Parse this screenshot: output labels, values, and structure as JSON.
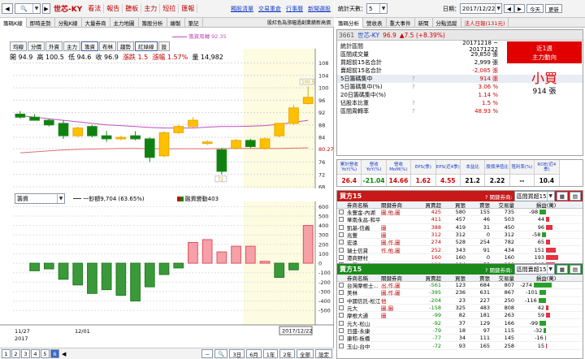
{
  "left": {
    "nav": {
      "back": "◀",
      "forward": "▶",
      "search_icon": "magnifier",
      "stock": "世芯-KY",
      "buttons": [
        "看法",
        "報告",
        "聽板",
        "主力",
        "短拉",
        "匯報"
      ],
      "links": [
        "獨股清單",
        "交易重倉",
        "行事曆",
        "新聞選股"
      ]
    },
    "tabs": [
      "籌碼K線",
      "即時走勢",
      "分點K線",
      "大量券商",
      "主力地圖",
      "籌股分析",
      "繪製",
      "筆記"
    ],
    "tabs_right": "股紅色為漲幅過創業績新高價",
    "chart_tools": [
      "均線",
      "分價",
      "外資",
      "主力",
      "籌資",
      "布林",
      "趨勢",
      "紅綠線",
      "設"
    ],
    "ohlc": {
      "open": "開 94.9",
      "high": "高 100.5",
      "low": "低 94.6",
      "close": "收 96.9",
      "change_label": "漲跌",
      "change": "1.5",
      "pct_label": "漲幅",
      "pct": "1.57%",
      "vol_label": "量",
      "vol": "14,982"
    },
    "turnover_label": "籌資周轉 92.35",
    "price_axis": [
      "108",
      "104",
      "100",
      "96",
      "92",
      "88",
      "84",
      "80.27",
      "76",
      "72",
      "68"
    ],
    "price_tags": {
      "high": "100.5",
      "low": "72",
      "ref": "80.27"
    },
    "lower": {
      "select": "籌資",
      "legend1": "一鈔額9,704 (63.65%)",
      "legend2": "融資變動403"
    },
    "lower_axis": [
      "600",
      "500",
      "400",
      "300",
      "200",
      "100",
      "0",
      "-100",
      "-200",
      "-300",
      "-400",
      "-500"
    ],
    "dates": [
      "11/27",
      "2017",
      "12/01",
      "2017/12/22"
    ],
    "pages": [
      "1",
      "2",
      "3",
      "4",
      "5",
      "6"
    ],
    "period_buttons": [
      "3日",
      "6月",
      "1年",
      "2年",
      "全部",
      "設定"
    ]
  },
  "right": {
    "top": {
      "days_label": "統計天數：",
      "days": "5",
      "date_label": "日期：",
      "date": "2017/12/22",
      "today": "今天",
      "refresh": "更新"
    },
    "tabs": [
      "籌碼分析",
      "營收表",
      "重大事件",
      "新聞",
      "分點追蹤",
      "法人日報(131元)"
    ],
    "summary": {
      "code": "3661",
      "name": "世芯-KY",
      "price": "96.9",
      "change": "▲7.5 (+8.39%)",
      "rows": [
        {
          "k": "統計區間",
          "m": "",
          "v": "20171218 ~ 20171222"
        },
        {
          "k": "區間成交量",
          "m": "",
          "v": "29,850 張"
        },
        {
          "k": "買超前15名合計",
          "m": "",
          "v": "2,999 張"
        },
        {
          "k": "賣超前15名合計",
          "m": "",
          "v": "-2,085 張"
        },
        {
          "k": "5日籌碼集中",
          "m": "?",
          "v": "914 張"
        },
        {
          "k": "5日籌碼集中(%)",
          "m": "?",
          "v": "3.06 %"
        },
        {
          "k": "20日籌碼集中(%)",
          "m": "",
          "v": "1.14 %"
        },
        {
          "k": "佔股本比重",
          "m": "?",
          "v": "1.5 %"
        },
        {
          "k": "區間周轉率",
          "m": "?",
          "v": "48.93 %"
        }
      ],
      "box_l1": "近1週",
      "box_l2": "主力動向",
      "verdict": "小買",
      "verdict_amt": "914 張"
    },
    "kpi": [
      {
        "h": "累計營收YoY(%)",
        "v": "26.4",
        "c": "#d00000"
      },
      {
        "h": "營收YoY(%)",
        "v": "-21.04",
        "c": "#008800"
      },
      {
        "h": "營收MoM(%)",
        "v": "14.66",
        "c": "#d00000"
      },
      {
        "h": "EPS(季)",
        "v": "1.62",
        "c": "#d00000"
      },
      {
        "h": "EPS(近4季)",
        "v": "4.55",
        "c": "#d00000"
      },
      {
        "h": "本益比",
        "v": "21.2",
        "c": "#000000"
      },
      {
        "h": "股價淨值比",
        "v": "2.22",
        "c": "#000000"
      },
      {
        "h": "殖利率(%)",
        "v": "--",
        "c": "#000000"
      },
      {
        "h": "ROE(近4季)",
        "v": "10.4",
        "c": "#000000"
      }
    ],
    "buy": {
      "title": "買方15",
      "filter_label": "? 關鍵券商:",
      "filter": "區間買超15",
      "cols": [
        "券商名稱",
        "關鍵券商",
        "買賣超",
        "買張",
        "賣張",
        "交易量",
        "損益(萬)"
      ],
      "rows": [
        [
          "永豐金-內湖",
          "圖,他,圖",
          "425",
          "580",
          "155",
          "735",
          "-98"
        ],
        [
          "華南永昌-和平",
          "",
          "411",
          "457",
          "46",
          "503",
          "44"
        ],
        [
          "凱基-信義",
          "圖",
          "388",
          "419",
          "31",
          "450",
          "96"
        ],
        [
          "兆豐",
          "圖",
          "312",
          "312",
          "0",
          "312",
          "-58"
        ],
        [
          "宏遠",
          "圖,作,圖",
          "274",
          "528",
          "254",
          "782",
          "65"
        ],
        [
          "瑞士信貸",
          "作,他,圖",
          "252",
          "343",
          "91",
          "434",
          "151"
        ],
        [
          "港商野村",
          "",
          "160",
          "160",
          "0",
          "160",
          "193"
        ],
        [
          "國票-長城",
          "",
          "129",
          "184",
          "55",
          "239",
          "143"
        ],
        [
          "國泰-敦南",
          "",
          "127",
          "191",
          "64",
          "255",
          "60"
        ]
      ]
    },
    "sell": {
      "title": "賣方15",
      "filter_label": "? 關鍵券商:",
      "filter": "區間賣超15",
      "cols": [
        "券商名稱",
        "關鍵券商",
        "買賣超",
        "買張",
        "賣張",
        "交易量",
        "損益(萬)"
      ],
      "rows": [
        [
          "台灣摩根士...",
          "出,作,圖",
          "-561",
          "123",
          "684",
          "807",
          "-274"
        ],
        [
          "美林",
          "圖,作,圖",
          "-395",
          "236",
          "631",
          "867",
          "-101"
        ],
        [
          "中國信託-松江",
          "他",
          "-204",
          "23",
          "227",
          "250",
          "-116"
        ],
        [
          "元大",
          "圖,圖",
          "-158",
          "325",
          "483",
          "808",
          "42"
        ],
        [
          "摩根大通",
          "圖",
          "-99",
          "82",
          "181",
          "263",
          "59"
        ],
        [
          "元大-松山",
          "",
          "-92",
          "37",
          "129",
          "166",
          "-99"
        ],
        [
          "日盛-永康",
          "",
          "-79",
          "18",
          "97",
          "115",
          "-32"
        ],
        [
          "康和-板橋",
          "",
          "-77",
          "34",
          "111",
          "145",
          "-16"
        ],
        [
          "玉山-台中",
          "",
          "-72",
          "93",
          "165",
          "258",
          "15"
        ]
      ]
    }
  },
  "chart_data": {
    "type": "bar",
    "title": "",
    "candles": [
      {
        "o": 91.5,
        "h": 92.5,
        "l": 90.0,
        "c": 90.5
      },
      {
        "o": 90.5,
        "h": 91.5,
        "l": 89.5,
        "c": 89.5
      },
      {
        "o": 89.5,
        "h": 90.0,
        "l": 87.5,
        "c": 88.0
      },
      {
        "o": 88.5,
        "h": 89.5,
        "l": 83.5,
        "c": 84.5
      },
      {
        "o": 84.5,
        "h": 87.5,
        "l": 84.0,
        "c": 87.0
      },
      {
        "o": 87.5,
        "h": 88.0,
        "l": 84.0,
        "c": 84.5
      },
      {
        "o": 84.5,
        "h": 86.0,
        "l": 82.5,
        "c": 83.5
      },
      {
        "o": 83.5,
        "h": 84.5,
        "l": 83.0,
        "c": 84.0
      },
      {
        "o": 84.5,
        "h": 86.0,
        "l": 83.0,
        "c": 83.5
      },
      {
        "o": 83.5,
        "h": 84.0,
        "l": 76.0,
        "c": 77.5
      },
      {
        "o": 78.0,
        "h": 86.0,
        "l": 77.5,
        "c": 85.5
      },
      {
        "o": 85.5,
        "h": 88.0,
        "l": 85.0,
        "c": 87.5
      },
      {
        "o": 87.5,
        "h": 90.5,
        "l": 87.0,
        "c": 89.5
      },
      {
        "o": 82.0,
        "h": 83.0,
        "l": 81.5,
        "c": 82.5
      },
      {
        "o": 80.0,
        "h": 80.5,
        "l": 72.0,
        "c": 73.0
      },
      {
        "o": 80.5,
        "h": 83.5,
        "l": 80.0,
        "c": 83.0
      },
      {
        "o": 83.0,
        "h": 83.5,
        "l": 80.5,
        "c": 81.0
      },
      {
        "o": 80.5,
        "h": 84.0,
        "l": 80.0,
        "c": 83.5
      },
      {
        "o": 84.5,
        "h": 88.0,
        "l": 84.0,
        "c": 88.5
      },
      {
        "o": 88.5,
        "h": 94.5,
        "l": 88.0,
        "c": 93.5
      },
      {
        "o": 94.9,
        "h": 100.5,
        "l": 94.6,
        "c": 96.9
      }
    ],
    "ma": [
      91.0,
      90.5,
      90.0,
      89.5,
      89.0,
      88.5,
      88.0,
      87.8,
      87.5,
      87.2,
      87.0,
      87.0,
      87.0,
      87.3,
      87.5,
      87.5,
      87.6,
      87.8,
      88.2,
      88.8,
      89.5
    ],
    "ma2": [
      79.0,
      79.3,
      79.6,
      79.9,
      80.1,
      80.2,
      80.3,
      80.4,
      80.4,
      80.3,
      80.3,
      80.3,
      80.3,
      80.3,
      80.4,
      80.4,
      80.4,
      80.4,
      80.4,
      80.5,
      80.6
    ],
    "flow": [
      0,
      -80,
      -60,
      -170,
      -230,
      -320,
      -280,
      -340,
      -400,
      -250,
      -120,
      -50,
      220,
      250,
      120,
      180,
      180,
      20,
      -150,
      -70,
      400
    ],
    "ylim_price": [
      68,
      110
    ],
    "ylim_flow": [
      -550,
      620
    ]
  }
}
